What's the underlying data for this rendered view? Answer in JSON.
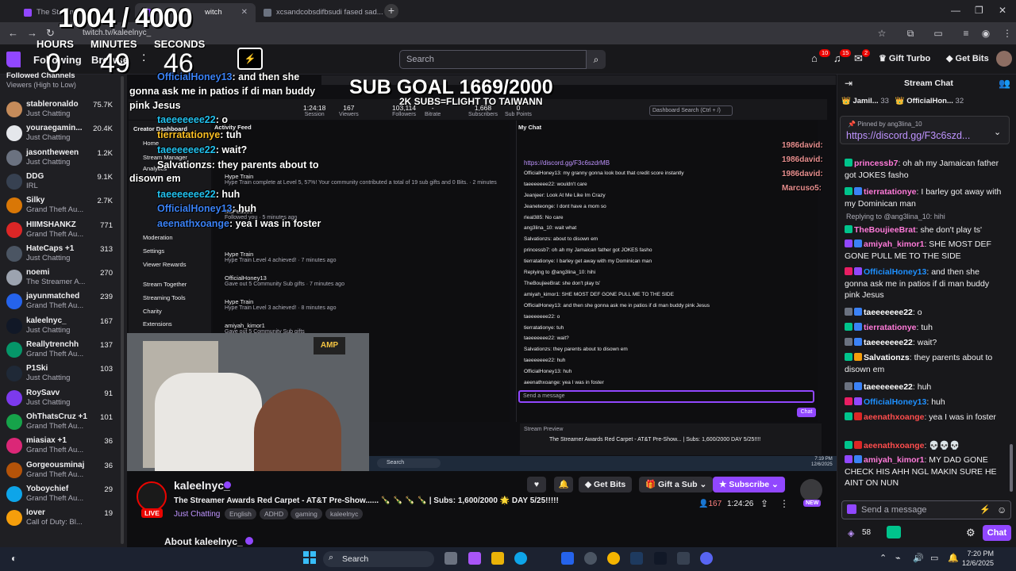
{
  "browser": {
    "tabs": [
      {
        "label": "The Streame",
        "active": false
      },
      {
        "label": "witch",
        "active": true
      },
      {
        "label": "xcsandcobsdifbsudi fased sad...",
        "active": false
      }
    ],
    "new_tab": "+",
    "url": "twitch.tv/kaleelnyc_"
  },
  "overlay": {
    "counter": "1004 / 4000",
    "countdown": {
      "hours_label": "HOURS",
      "hours": "0",
      "minutes_label": "MINUTES",
      "minutes": "49",
      "seconds_label": "SECONDS",
      "seconds": "46"
    },
    "sub_goal": "SUB GOAL 1669/2000",
    "sub_goal_note": "2K SUBS=FLIGHT TO TAIWANN",
    "chat_lines": [
      {
        "user": "OfficialHoney13",
        "text": ": and then she"
      },
      {
        "user": "",
        "text": "gonna ask me in patios if di man buddy"
      },
      {
        "user": "",
        "text": "pink Jesus"
      },
      {
        "user": "taeeeeeee22",
        "text": ": o"
      },
      {
        "user": "tierratationye",
        "text": ": tuh"
      },
      {
        "user": "taeeeeeee22",
        "text": ": wait?"
      },
      {
        "user": "Salvationzs",
        "text": ": they parents about to"
      },
      {
        "user": "",
        "text": "disown em"
      },
      {
        "user": "taeeeeeee22",
        "text": ": huh"
      },
      {
        "user": "OfficialHoney13",
        "text": ": huh"
      },
      {
        "user": "aeenathxoange",
        "text": ": yea I was in foster"
      }
    ],
    "right_names": [
      "1986david:",
      "1986david:",
      "1986david:",
      "Marcuso5:"
    ]
  },
  "topnav": {
    "following": "Following",
    "browse": "Browse",
    "search_placeholder": "Search",
    "badges": [
      "10",
      "15",
      "2"
    ],
    "turbo": "Gift Turbo",
    "get_bits": "Get Bits"
  },
  "sidebar": {
    "header": "Followed Channels",
    "subheader": "Viewers (High to Low)",
    "channels": [
      {
        "name": "stableronaldo",
        "game": "Just Chatting",
        "viewers": "75.7K",
        "color": "#c58b5a"
      },
      {
        "name": "youraegamin...",
        "game": "Just Chatting",
        "viewers": "20.4K",
        "color": "#e5e7eb"
      },
      {
        "name": "jasontheween",
        "game": "Just Chatting",
        "viewers": "1.2K",
        "color": "#6b7280"
      },
      {
        "name": "DDG",
        "game": "IRL",
        "viewers": "9.1K",
        "color": "#374151"
      },
      {
        "name": "Silky",
        "game": "Grand Theft Au...",
        "viewers": "2.7K",
        "color": "#d97706"
      },
      {
        "name": "HIIMSHANKZ",
        "game": "Grand Theft Au...",
        "viewers": "771",
        "color": "#dc2626"
      },
      {
        "name": "HateCaps +1",
        "game": "Just Chatting",
        "viewers": "313",
        "color": "#4b5563"
      },
      {
        "name": "noemi",
        "game": "The Streamer A...",
        "viewers": "270",
        "color": "#9ca3af"
      },
      {
        "name": "jayunmatched",
        "game": "Grand Theft Au...",
        "viewers": "239",
        "color": "#2563eb"
      },
      {
        "name": "kaleelnyc_",
        "game": "Just Chatting",
        "viewers": "167",
        "color": "#111827"
      },
      {
        "name": "Reallytrenchh",
        "game": "Grand Theft Au...",
        "viewers": "137",
        "color": "#059669"
      },
      {
        "name": "P1Ski",
        "game": "Just Chatting",
        "viewers": "103",
        "color": "#1f2937"
      },
      {
        "name": "RoySavv",
        "game": "Just Chatting",
        "viewers": "91",
        "color": "#7c3aed"
      },
      {
        "name": "OhThatsCruz +1",
        "game": "Grand Theft Au...",
        "viewers": "101",
        "color": "#16a34a"
      },
      {
        "name": "miasiax +1",
        "game": "Grand Theft Au...",
        "viewers": "36",
        "color": "#db2777"
      },
      {
        "name": "Gorgeousminaj",
        "game": "Grand Theft Au...",
        "viewers": "36",
        "color": "#b45309"
      },
      {
        "name": "Yoboychief",
        "game": "Grand Theft Au...",
        "viewers": "29",
        "color": "#0ea5e9"
      },
      {
        "name": "lover",
        "game": "Call of Duty: Bl...",
        "viewers": "19",
        "color": "#f59e0b"
      }
    ]
  },
  "dashboard": {
    "stats": [
      {
        "value": "1:24:18",
        "label": "Session"
      },
      {
        "value": "167",
        "label": "Viewers"
      },
      {
        "value": "103,114",
        "label": "Followers"
      },
      {
        "value": "-",
        "label": "Bitrate"
      },
      {
        "value": "1,668",
        "label": "Subscribers"
      },
      {
        "value": "0",
        "label": "Sub Points"
      }
    ],
    "search": "Dashboard Search (Ctrl + /)",
    "nav": [
      "Creator Dashboard",
      "Home",
      "Stream Manager",
      "Analytics",
      "Moderation",
      "Settings",
      "Viewer Rewards",
      "Stream Together",
      "Streaming Tools",
      "Charity",
      "Extensions"
    ],
    "feed_title": "Activity Feed",
    "feed": [
      {
        "title": "Hype Train",
        "sub": "Hype Train complete at Level 5, 57%! Your community contributed a total of 19 sub gifts and 0 Bits. · 2 minutes"
      },
      {
        "title": "MsPeacee",
        "sub": "Followed you · 5 minutes ago"
      },
      {
        "title": "Hype Train",
        "sub": "Hype Train Level 4 achieved! · 7 minutes ago"
      },
      {
        "title": "OfficialHoney13",
        "sub": "Gave out 5 Community Sub gifts · 7 minutes ago"
      },
      {
        "title": "Hype Train",
        "sub": "Hype Train Level 3 achieved! · 8 minutes ago"
      },
      {
        "title": "amiyah_kimor1",
        "sub": "Gave out 5 Community Sub gifts"
      }
    ],
    "mychat_title": "My Chat",
    "mychat_lines": [
      "https://discord.gg/F3c6szdrMB",
      "OfficialHoney13: my granny gonna look bout that credit score instantly",
      "taeeeeeee22: wouldn't care",
      "Jeanjeer: Look At Me Like Im Crazy",
      "Jeaneteonge: I dont have a mom so",
      "rleal385: No care",
      "ang3lina_10: wait what",
      "Salvationzs: about to disown em",
      "princessb7: oh ah my Jamaican father got JOKES fasho",
      "tierratationye: I barley get away with my Dominican man",
      "Replying to @ang3lina_10: hihi",
      "TheBoujieeBrat: she don't play ts'",
      "amiyah_kimor1: SHE MOST DEF GONE PULL ME TO THE SIDE",
      "OfficialHoney13: and then she gonna ask me in patios if di man buddy pink Jesus",
      "taeeeeeee22: o",
      "tierratationye: tuh",
      "taeeeeeee22: wait?",
      "Salvationzs: they parents about to disown em",
      "taeeeeeee22: huh",
      "OfficialHoney13: huh",
      "aeenathxoange: yea I was in foster"
    ],
    "mychat_input": "Send a message",
    "mychat_btn": "Chat",
    "preview_title": "Stream Preview",
    "preview_text": "The Streamer Awards Red Carpet - AT&T Pre-Show... | Subs: 1,600/2000 DAY 5/25!!!!",
    "inner_search": "Search",
    "inner_time": "7:19 PM",
    "inner_date": "12/6/2025",
    "cam_sign": "AMP"
  },
  "stream": {
    "channel": "kaleelnyc_",
    "live": "LIVE",
    "title": "The Streamer Awards Red Carpet - AT&T Pre-Show...... 🍾 🍾 🍾 🍾 | Subs: 1,600/2000 🌟 DAY 5/25!!!!!",
    "category": "Just Chatting",
    "tags": [
      "English",
      "ADHD",
      "gaming",
      "kaleelnyc"
    ],
    "get_bits": "Get Bits",
    "gift": "Gift a Sub",
    "subscribe": "Subscribe",
    "viewers": "167",
    "uptime": "1:24:26",
    "new_badge": "NEW",
    "about": "About kaleelnyc_"
  },
  "chat": {
    "title": "Stream Chat",
    "leaderboard": [
      {
        "name": "Jamil...",
        "count": "33"
      },
      {
        "name": "OfficialHon...",
        "count": "32"
      }
    ],
    "pinned_by": "Pinned by ang3lina_10",
    "pinned_link": "https://discord.gg/F3c6szd...",
    "messages": [
      {
        "user": "princessb7",
        "color": "#ff7ad9",
        "text": ": oh ah my Jamaican father got JOKES fasho",
        "badges": [
          "#00c48c"
        ]
      },
      {
        "user": "tierratationye",
        "color": "#ff7ad9",
        "text": ": I barley got away with my Dominican man",
        "badges": [
          "#00c48c",
          "#3b82f6"
        ]
      },
      {
        "user": "TheBoujieeBrat",
        "color": "#ff7ad9",
        "text": ": she don't play ts'",
        "badges": [
          "#00c48c"
        ],
        "reply": "Replying to @ang3lina_10: hihi"
      },
      {
        "user": "amiyah_kimor1",
        "color": "#ff7ad9",
        "text": ": SHE MOST DEF GONE PULL ME TO THE SIDE",
        "badges": [
          "#9147ff",
          "#3b82f6"
        ]
      },
      {
        "user": "OfficialHoney13",
        "color": "#1e90ff",
        "text": ": and then she gonna ask me in patios if di man buddy pink Jesus",
        "badges": [
          "#e91e63",
          "#9147ff"
        ]
      },
      {
        "user": "taeeeeeee22",
        "color": "#ffffff",
        "text": ": o",
        "badges": [
          "#6b7280",
          "#3b82f6"
        ]
      },
      {
        "user": "tierratationye",
        "color": "#ff7ad9",
        "text": ": tuh",
        "badges": [
          "#00c48c",
          "#3b82f6"
        ]
      },
      {
        "user": "taeeeeeee22",
        "color": "#ffffff",
        "text": ": wait?",
        "badges": [
          "#6b7280",
          "#3b82f6"
        ]
      },
      {
        "user": "Salvationzs",
        "color": "#ffffff",
        "text": ": they parents about to disown em",
        "badges": [
          "#00c48c",
          "#f59e0b"
        ]
      },
      {
        "user": "taeeeeeee22",
        "color": "#ffffff",
        "text": ": huh",
        "badges": [
          "#6b7280",
          "#3b82f6"
        ]
      },
      {
        "user": "OfficialHoney13",
        "color": "#1e90ff",
        "text": ": huh",
        "badges": [
          "#e91e63",
          "#9147ff"
        ]
      },
      {
        "user": "aeenathxoange",
        "color": "#ff4d4d",
        "text": ": yea I was in foster",
        "badges": [
          "#00c48c",
          "#dc2626"
        ]
      },
      {
        "user": "aeenathxoange",
        "color": "#ff4d4d",
        "text": ": 💀💀💀",
        "badges": [
          "#00c48c",
          "#dc2626"
        ]
      },
      {
        "user": "amiyah_kimor1",
        "color": "#ff7ad9",
        "text": ": MY DAD GONE CHECK HIS AHH NGL MAKIN SURE HE AINT ON NUN",
        "badges": [
          "#9147ff",
          "#3b82f6"
        ]
      }
    ],
    "input_placeholder": "Send a message",
    "points": "58",
    "chat_button": "Chat"
  },
  "taskbar": {
    "search": "Search",
    "time": "7:20 PM",
    "date": "12/6/2025"
  }
}
